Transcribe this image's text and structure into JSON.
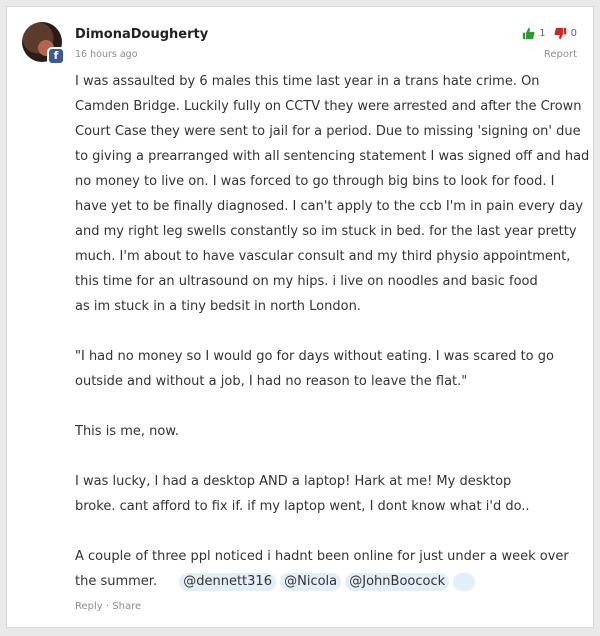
{
  "comment": {
    "author": "DimonaDougherty",
    "timestamp": "16 hours ago",
    "upvotes": "1",
    "downvotes": "0",
    "report_label": "Report",
    "paragraphs": [
      [
        "I was assaulted by 6 males this time last year in a trans hate crime.  On",
        "Camden Bridge.  Luckily fully on CCTV they were arrested and after the Crown",
        "Court Case they were sent to jail for a period. Due to missing 'signing on' due",
        "to giving a prearranged with all sentencing statement I was signed off and had",
        "no money to live on. I was forced to go through big bins to look for food.  I",
        "have yet to be finally diagnosed. I can't apply to the ccb I'm in pain every day",
        "and my right leg swells constantly so im stuck in bed. for the last year pretty",
        "much. I'm about to have  vascular consult and my third physio appointment,",
        "this time for an ultrasound on my hips. i live on noodles and basic food",
        "as im stuck in a tiny bedsit in north London."
      ],
      [
        "\"I had no money so I would go for days without eating. I was scared to go",
        "outside and without a job, I had no reason to leave the flat.\""
      ],
      [
        "This is me, now."
      ],
      [
        "I was lucky, I had a desktop AND a laptop! Hark at me!  My desktop",
        "broke. cant afford to fix if. if my laptop went, I dont know what i'd do.."
      ],
      [
        "A couple of three ppl noticed i hadnt been online for just under a week over"
      ]
    ],
    "last_line_prefix": "the summer.",
    "mentions": [
      "@dennett316",
      "@Nicola",
      "@JohnBoocock"
    ],
    "actions": {
      "reply": "Reply",
      "separator": "·",
      "share": "Share"
    },
    "colors": {
      "upvote": "#2e9a2e",
      "downvote": "#d62222",
      "mention_bg": "#e3eef7",
      "facebook": "#3b5998"
    },
    "icons": {
      "up": "thumbs-up-icon",
      "down": "thumbs-down-icon",
      "badge": "facebook-icon"
    }
  }
}
